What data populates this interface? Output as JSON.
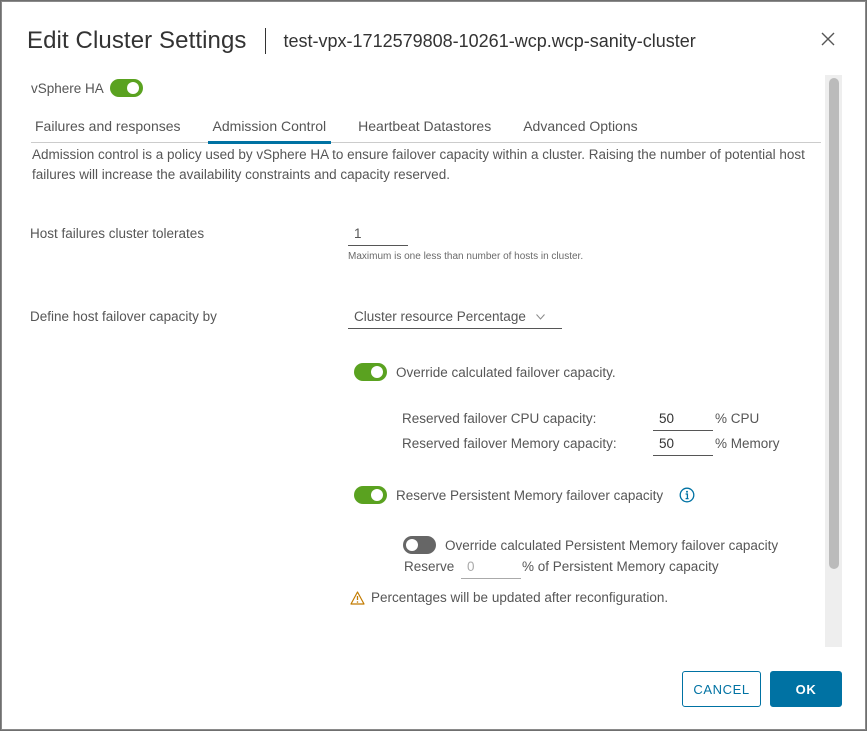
{
  "dialog": {
    "title": "Edit Cluster Settings",
    "subtitle": "test-vpx-1712579808-10261-wcp.wcp-sanity-cluster",
    "close_icon": "close-icon"
  },
  "ha": {
    "label": "vSphere HA",
    "enabled": true
  },
  "tabs": [
    {
      "label": "Failures and responses",
      "active": false
    },
    {
      "label": "Admission Control",
      "active": true
    },
    {
      "label": "Heartbeat Datastores",
      "active": false
    },
    {
      "label": "Advanced Options",
      "active": false
    }
  ],
  "admission": {
    "description": "Admission control is a policy used by vSphere HA to ensure failover capacity within a cluster. Raising the number of potential host failures will increase the availability constraints and capacity reserved.",
    "host_failures": {
      "label": "Host failures cluster tolerates",
      "value": "1",
      "hint": "Maximum is one less than number of hosts in cluster."
    },
    "failover_capacity": {
      "label": "Define host failover capacity by",
      "selected": "Cluster resource Percentage"
    },
    "override": {
      "label": "Override calculated failover capacity.",
      "enabled": true,
      "cpu_label": "Reserved failover CPU capacity:",
      "cpu_value": "50",
      "cpu_unit": "% CPU",
      "memory_label": "Reserved failover Memory capacity:",
      "memory_value": "50",
      "memory_unit": "% Memory"
    },
    "pmem": {
      "label": "Reserve Persistent Memory failover capacity",
      "enabled": true,
      "info_icon": "info-icon",
      "override_label": "Override calculated Persistent Memory failover capacity",
      "override_enabled": false,
      "reserve_label": "Reserve",
      "reserve_value": "0",
      "reserve_unit": "% of Persistent Memory capacity"
    },
    "warning": {
      "icon": "warning-icon",
      "text": "Percentages will be updated after reconfiguration."
    }
  },
  "footer": {
    "cancel_label": "CANCEL",
    "ok_label": "OK"
  },
  "colors": {
    "accent": "#0072a3",
    "toggle_on": "#5aa220",
    "toggle_off": "#666666",
    "warning": "#c27b00"
  }
}
